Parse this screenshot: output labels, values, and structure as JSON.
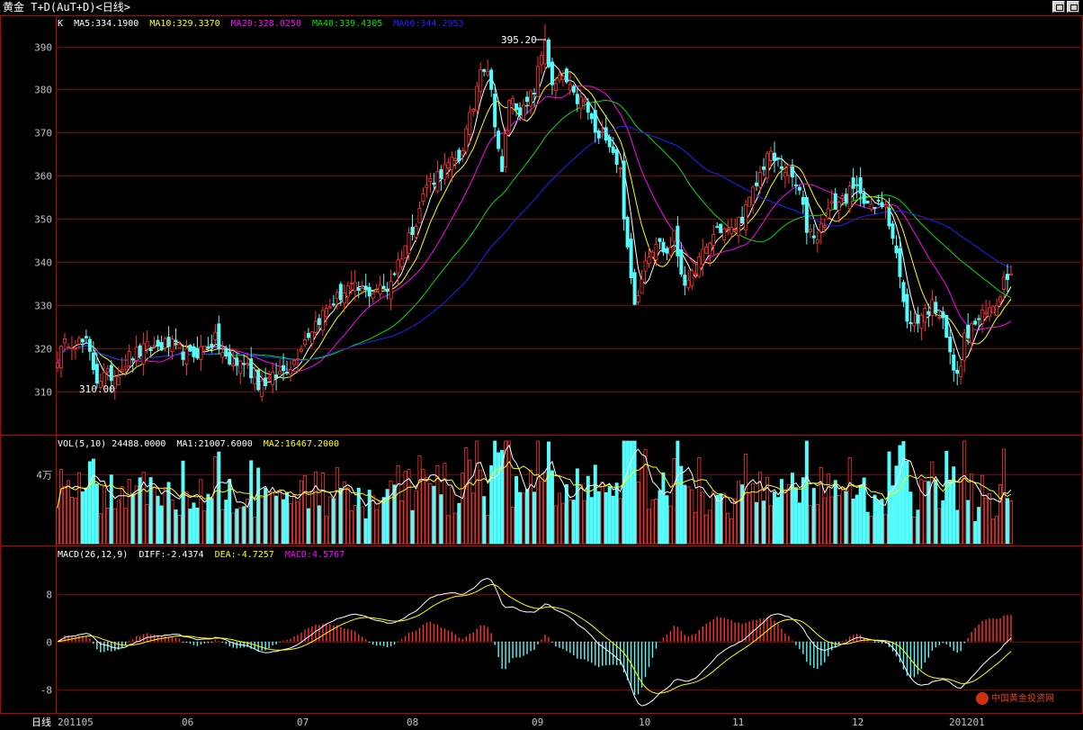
{
  "window": {
    "title": "黄金 T+D(AuT+D)<日线>",
    "buttons": [
      "restore-icon",
      "maximize-icon"
    ]
  },
  "colors": {
    "up": "#ff3232",
    "down": "#54fcfc",
    "ma5": "#ffffff",
    "ma10": "#ffff00",
    "ma20": "#ff00ff",
    "ma40": "#00e000",
    "ma60": "#2020ff",
    "grid": "#800000",
    "vol_ma1": "#ffffff",
    "vol_ma2": "#ffff00",
    "macd_diff": "#ffffff",
    "macd_dea": "#ffff00"
  },
  "price_panel": {
    "legend_prefix": "K",
    "ma_labels": [
      "MA5:334.1900",
      "MA10:329.3370",
      "MA20:328.0250",
      "MA40:339.4305",
      "MA60:344.2953"
    ],
    "yticks": [
      "390",
      "380",
      "370",
      "360",
      "350",
      "340",
      "330",
      "320",
      "310"
    ],
    "high_annotation": "395.20",
    "low_annotation": "310.00"
  },
  "volume_panel": {
    "legend": "VOL(5,10) 24488.0000",
    "ma1_label": "MA1:21007.6000",
    "ma2_label": "MA2:16467.2000",
    "ytick": "4万"
  },
  "macd_panel": {
    "legend": "MACD(26,12,9)",
    "diff_label": "DIFF:-2.4374",
    "dea_label": "DEA:-4.7257",
    "macd_label": "MACD:4.5767",
    "yticks": [
      "8",
      "0",
      "-8"
    ]
  },
  "xaxis": {
    "period_label": "日线",
    "labels": [
      "201105",
      "06",
      "07",
      "08",
      "09",
      "10",
      "11",
      "12",
      "201201"
    ]
  },
  "watermark": {
    "text": "中国黄金投资网"
  },
  "chart_data": {
    "type": "candlestick",
    "title": "黄金 T+D(AuT+D)<日线>",
    "period": "daily",
    "x_range": [
      "2011-05",
      "2012-01"
    ],
    "price_ylim": [
      300,
      397
    ],
    "price_waypoints": [
      [
        0,
        318
      ],
      [
        3,
        322
      ],
      [
        8,
        321
      ],
      [
        11,
        313
      ],
      [
        16,
        314
      ],
      [
        20,
        318
      ],
      [
        25,
        320
      ],
      [
        31,
        321
      ],
      [
        37,
        318
      ],
      [
        44,
        322
      ],
      [
        48,
        316
      ],
      [
        52,
        317
      ],
      [
        56,
        312
      ],
      [
        60,
        313
      ],
      [
        66,
        317
      ],
      [
        68,
        321
      ],
      [
        72,
        326
      ],
      [
        76,
        330
      ],
      [
        81,
        334
      ],
      [
        86,
        333
      ],
      [
        92,
        334
      ],
      [
        96,
        342
      ],
      [
        100,
        350
      ],
      [
        103,
        358
      ],
      [
        107,
        361
      ],
      [
        112,
        364
      ],
      [
        116,
        376
      ],
      [
        118,
        386
      ],
      [
        120,
        385
      ],
      [
        122,
        373
      ],
      [
        124,
        360
      ],
      [
        126,
        378
      ],
      [
        130,
        375
      ],
      [
        133,
        380
      ],
      [
        136,
        392
      ],
      [
        138,
        380
      ],
      [
        141,
        383
      ],
      [
        144,
        378
      ],
      [
        147,
        377
      ],
      [
        151,
        368
      ],
      [
        153,
        370
      ],
      [
        155,
        366
      ],
      [
        157,
        361
      ],
      [
        159,
        342
      ],
      [
        161,
        330
      ],
      [
        164,
        341
      ],
      [
        167,
        345
      ],
      [
        170,
        342
      ],
      [
        172,
        346
      ],
      [
        174,
        338
      ],
      [
        176,
        334
      ],
      [
        178,
        339
      ],
      [
        181,
        343
      ],
      [
        184,
        348
      ],
      [
        188,
        347
      ],
      [
        192,
        352
      ],
      [
        195,
        358
      ],
      [
        198,
        365
      ],
      [
        201,
        363
      ],
      [
        204,
        361
      ],
      [
        207,
        356
      ],
      [
        209,
        348
      ],
      [
        212,
        346
      ],
      [
        215,
        352
      ],
      [
        218,
        354
      ],
      [
        221,
        356
      ],
      [
        224,
        357
      ],
      [
        227,
        352
      ],
      [
        231,
        354
      ],
      [
        234,
        342
      ],
      [
        236,
        330
      ],
      [
        238,
        325
      ],
      [
        241,
        328
      ],
      [
        244,
        330
      ],
      [
        247,
        328
      ],
      [
        249,
        318
      ],
      [
        251,
        313
      ],
      [
        253,
        322
      ],
      [
        256,
        326
      ],
      [
        259,
        328
      ],
      [
        262,
        331
      ],
      [
        264,
        336
      ],
      [
        266,
        339
      ]
    ],
    "candle_count": 267,
    "price_extremes": {
      "high": 395.2,
      "low": 310.0
    },
    "moving_averages": {
      "MA5": 334.19,
      "MA10": 329.337,
      "MA20": 328.025,
      "MA40": 339.4305,
      "MA60": 344.2953
    },
    "volume": {
      "last": 24488,
      "MA1": 21007.6,
      "MA2": 16467.2,
      "ytick_value": 40000,
      "ylim": [
        0,
        62000
      ]
    },
    "macd": {
      "params": [
        26,
        12,
        9
      ],
      "DIFF": -2.4374,
      "DEA": -4.7257,
      "MACD": 4.5767,
      "ylim": [
        -12,
        16
      ]
    }
  }
}
